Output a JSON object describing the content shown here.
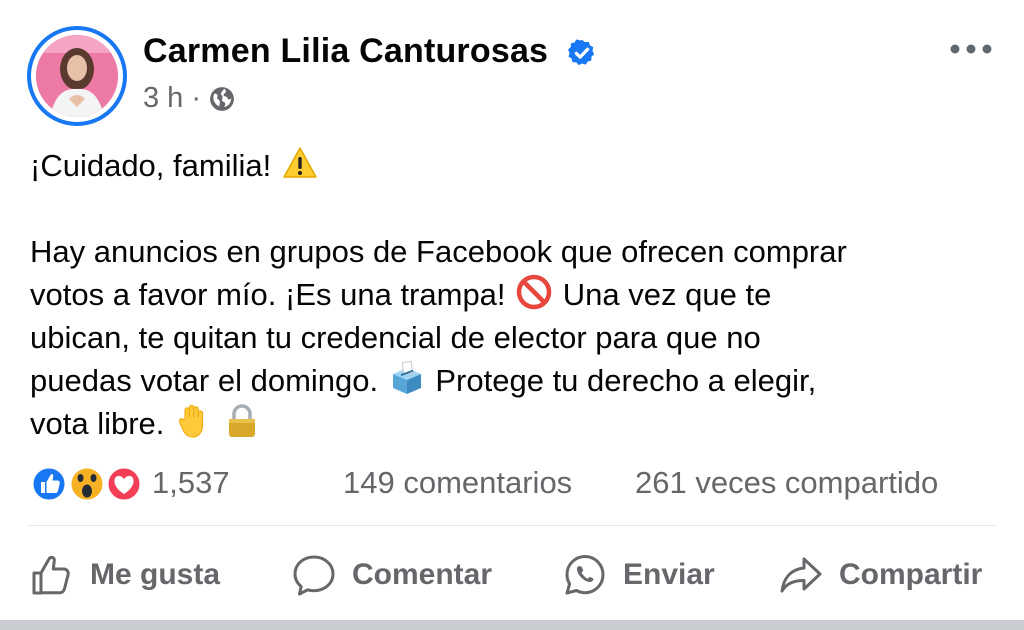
{
  "post": {
    "author": "Carmen Lilia Canturosas",
    "time": "3 h",
    "separator": "·",
    "lines": [
      "¡Cuidado, familia!",
      "Hay anuncios en grupos de Facebook que ofrecen comprar",
      "votos a favor mío. ¡Es una trampa!",
      "Una vez que te",
      "ubican, te quitan tu credencial de elector para que no",
      "puedas votar el domingo.",
      "Protege tu derecho a elegir,",
      "vota libre."
    ],
    "emojis": [
      "warning-emoji",
      "prohibited-emoji",
      "ballot-box-emoji",
      "raised-hand-emoji",
      "locked-emoji"
    ]
  },
  "stats": {
    "reactions_count": "1,537",
    "comments": "149 comentarios",
    "shares": "261 veces compartido",
    "reaction_icons": [
      "like-reaction-icon",
      "wow-reaction-icon",
      "love-reaction-icon"
    ]
  },
  "actions": {
    "like": "Me gusta",
    "comment": "Comentar",
    "send": "Enviar",
    "share": "Compartir"
  },
  "colors": {
    "accent": "#1877f2",
    "secondary_text": "#65676b",
    "love": "#f33e58",
    "wow": "#f7b125"
  }
}
